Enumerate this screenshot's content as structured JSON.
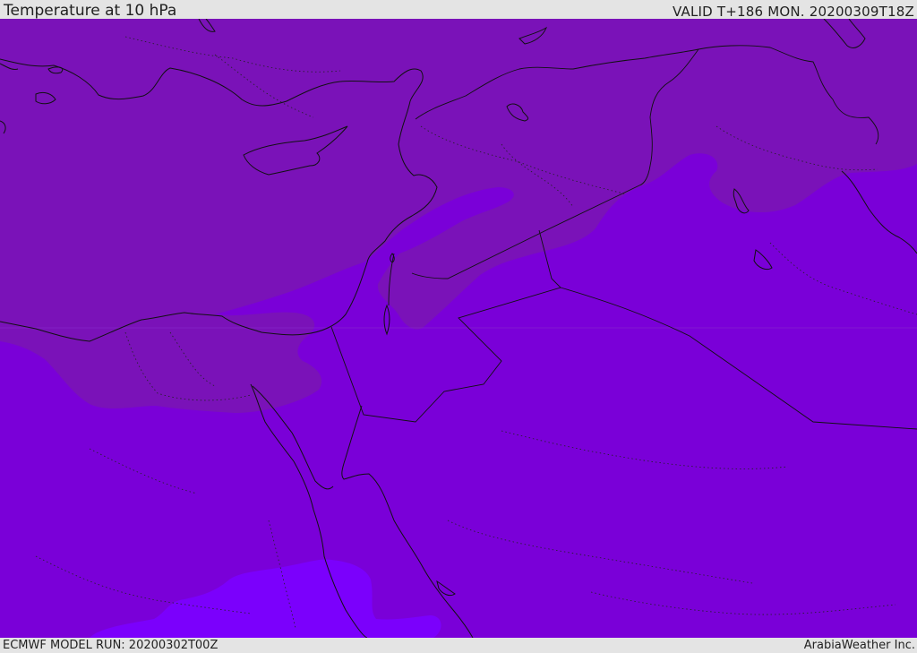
{
  "header": {
    "title": "Temperature at 10 hPa",
    "valid": "VALID T+186 MON. 20200309T18Z"
  },
  "footer": {
    "model_run": "ECMWF MODEL RUN: 20200302T00Z",
    "credit": "ArabiaWeather Inc."
  },
  "map": {
    "variable": "temperature",
    "level_hpa": 10,
    "colors": {
      "warm_band": "#7a12b8",
      "mid_band": "#7a00d8",
      "cool_band": "#7b00fc",
      "coastline": "#111111",
      "border": "#111111"
    }
  }
}
